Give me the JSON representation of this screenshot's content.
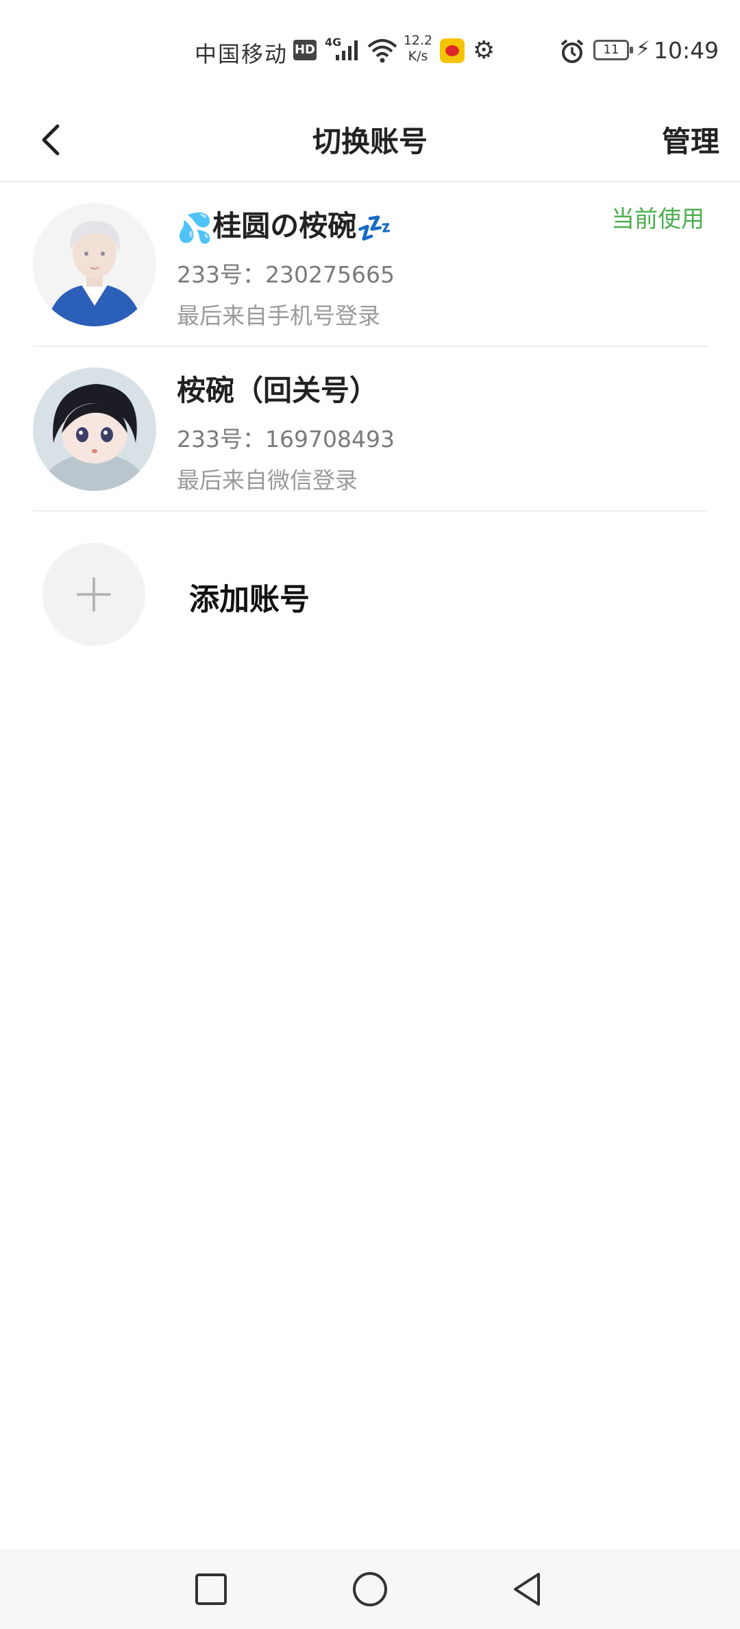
{
  "status_bar": {
    "carrier": "中国移动",
    "hd": "HD",
    "network": "4G",
    "speed_value": "12.2",
    "speed_unit": "K/s",
    "battery": "11",
    "time": "10:49",
    "icons": [
      "hd-icon",
      "signal-icon",
      "wifi-icon",
      "weibo-icon",
      "gear-icon",
      "alarm-icon",
      "battery-icon",
      "charging-icon"
    ]
  },
  "header": {
    "title": "切换账号",
    "manage_label": "管理",
    "back_icon": "chevron-left-icon"
  },
  "accounts": [
    {
      "name_prefix_emoji": "💦",
      "name": "桂圆の桉碗",
      "name_suffix_emoji": "💤",
      "id_text": "233号：230275665",
      "login_text": "最后来自手机号登录",
      "badge": "当前使用"
    },
    {
      "name": "桉碗（回关号）",
      "id_text": "233号：169708493",
      "login_text": "最后来自微信登录"
    }
  ],
  "add_account": {
    "label": "添加账号",
    "icon": "plus-icon"
  },
  "colors": {
    "accent_green": "#4caf50",
    "text_primary": "#222222",
    "text_secondary": "#7a7a7a",
    "divider": "#ececec"
  },
  "system_nav": {
    "icons": [
      "recents-square-icon",
      "home-circle-icon",
      "back-triangle-icon"
    ]
  }
}
